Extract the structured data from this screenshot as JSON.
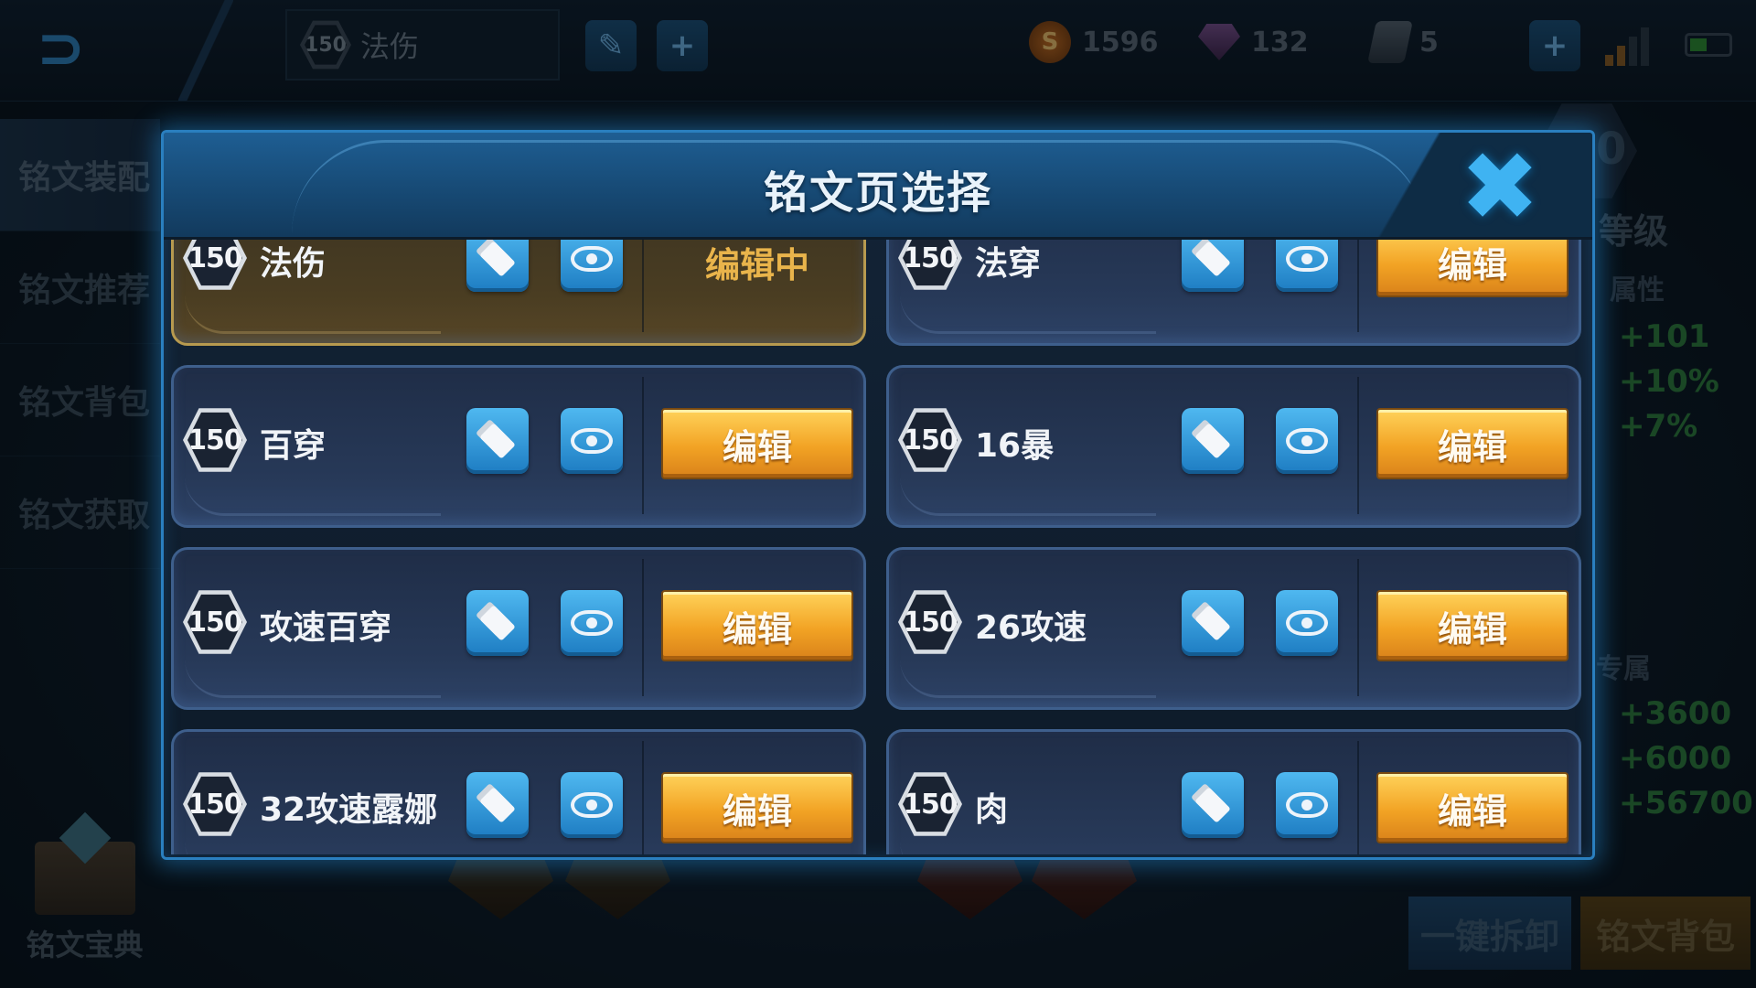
{
  "topbar": {
    "current_level": "150",
    "current_page_name": "法伤",
    "add_icon": "+",
    "currencies": [
      {
        "icon": "coin-icon",
        "value": "1596"
      },
      {
        "icon": "gem-icon",
        "value": "132"
      },
      {
        "icon": "ticket-icon",
        "value": "5"
      }
    ]
  },
  "sidebar": {
    "items": [
      "铭文装配",
      "铭文推荐",
      "铭文背包",
      "铭文获取"
    ],
    "book_label": "铭文宝典"
  },
  "right_panel": {
    "level_digit": "0",
    "level_label": "等级",
    "attr_label": "属性",
    "attr_values": [
      "+101",
      "+10%",
      "+7%"
    ],
    "exclusive_label": "专属",
    "exclusive_values": [
      "+3600",
      "+6000",
      "+56700"
    ]
  },
  "bottom": {
    "unequip_all": "一键拆卸",
    "bag": "铭文背包"
  },
  "modal": {
    "title": "铭文页选择",
    "close_icon": "close-icon",
    "edit_label": "编辑",
    "editing_label": "编辑中",
    "pages": [
      {
        "level": "150",
        "name": "法伤",
        "active": true
      },
      {
        "level": "150",
        "name": "法穿",
        "active": false
      },
      {
        "level": "150",
        "name": "百穿",
        "active": false
      },
      {
        "level": "150",
        "name": "16暴",
        "active": false
      },
      {
        "level": "150",
        "name": "攻速百穿",
        "active": false
      },
      {
        "level": "150",
        "name": "26攻速",
        "active": false
      },
      {
        "level": "150",
        "name": "32攻速露娜",
        "active": false
      },
      {
        "level": "150",
        "name": "肉",
        "active": false
      }
    ]
  },
  "colors": {
    "accent_blue": "#2a7fbf",
    "edit_orange": "#f2a324",
    "editing_gold": "#e9b44b",
    "stat_green": "#2f8a3a"
  }
}
